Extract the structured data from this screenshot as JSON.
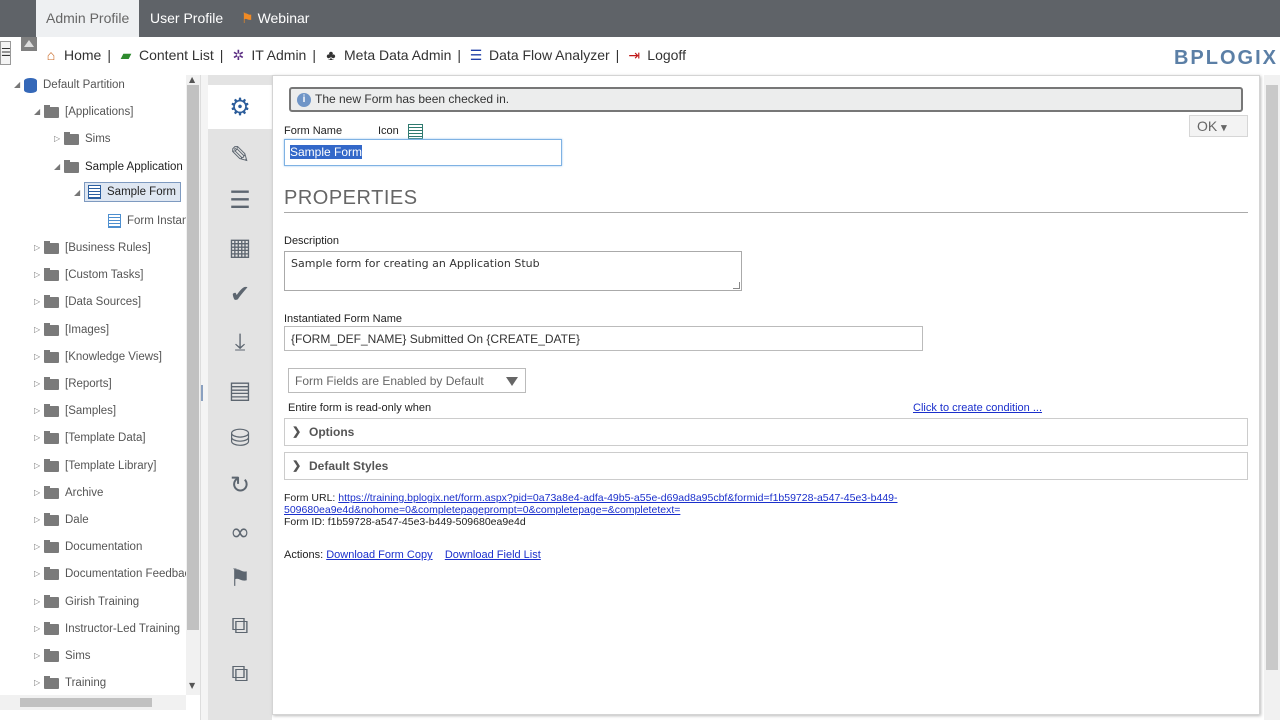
{
  "tabs": [
    {
      "label": "Admin Profile",
      "active": true
    },
    {
      "label": "User Profile",
      "active": false
    },
    {
      "label": "Webinar",
      "active": false,
      "icon": "flag-icon"
    }
  ],
  "nav": {
    "menu_toggle": "☰",
    "items": [
      {
        "label": "Home",
        "icon": "home-icon"
      },
      {
        "label": "Content List",
        "icon": "folder-icon"
      },
      {
        "label": "IT Admin",
        "icon": "gear-icon"
      },
      {
        "label": "Meta Data Admin",
        "icon": "hierarchy-icon"
      },
      {
        "label": "Data Flow Analyzer",
        "icon": "database-icon"
      },
      {
        "label": "Logoff",
        "icon": "logoff-icon"
      }
    ],
    "separator": "|",
    "logo": "BPLOGIX"
  },
  "tree": {
    "root": "Default Partition",
    "applications": "[Applications]",
    "sims_child": "Sims",
    "sample_application": "Sample Application",
    "sample_form": "Sample Form",
    "form_instances": "Form Instances",
    "folders": [
      "[Business Rules]",
      "[Custom Tasks]",
      "[Data Sources]",
      "[Images]",
      "[Knowledge Views]",
      "[Reports]",
      "[Samples]",
      "[Template Data]",
      "[Template Library]",
      "Archive",
      "Dale",
      "Documentation",
      "Documentation Feedback",
      "Girish Training",
      "Instructor-Led Training",
      "Sims",
      "Training"
    ]
  },
  "rail": {
    "icons": [
      "settings-gear-icon",
      "edit-icon",
      "list-icon",
      "table-icon",
      "checkmark-icon",
      "import-icon",
      "form-list-icon",
      "database-add-icon",
      "refresh-clock-icon",
      "link-icon",
      "flag-icon",
      "copy-icon",
      "duplicate-icon"
    ]
  },
  "main": {
    "notice": "The new Form has been checked in.",
    "ok_label": "OK",
    "form_name_label": "Form Name",
    "icon_label": "Icon",
    "form_name_value": "Sample Form",
    "properties_heading": "PROPERTIES",
    "description_label": "Description",
    "description_value": "Sample form for creating an Application Stub",
    "instantiated_label": "Instantiated Form Name",
    "instantiated_value": "{FORM_DEF_NAME} Submitted On {CREATE_DATE}",
    "fields_select_value": "Form Fields are Enabled by Default",
    "readonly_label": "Entire form is read-only when",
    "create_condition_link": "Click to create condition ...",
    "options_label": "Options",
    "default_styles_label": "Default Styles",
    "form_url_label": "Form URL:",
    "form_url_line1": "https://training.bplogix.net/form.aspx?pid=0a73a8e4-adfa-49b5-a55e-d69ad8a95cbf&formid=f1b59728-a547-45e3-b449-",
    "form_url_line2": "509680ea9e4d&nohome=0&completepageprompt=0&completepage=&completetext=",
    "form_id_label": "Form ID:",
    "form_id_value": "f1b59728-a547-45e3-b449-509680ea9e4d",
    "actions_label": "Actions:",
    "download_copy": "Download Form Copy",
    "download_fields": "Download Field List"
  },
  "colors": {
    "tabbar_bg": "#5f6368",
    "accent_blue": "#2c5d9b",
    "link": "#1a2fcc",
    "flag_orange": "#f08a24"
  }
}
